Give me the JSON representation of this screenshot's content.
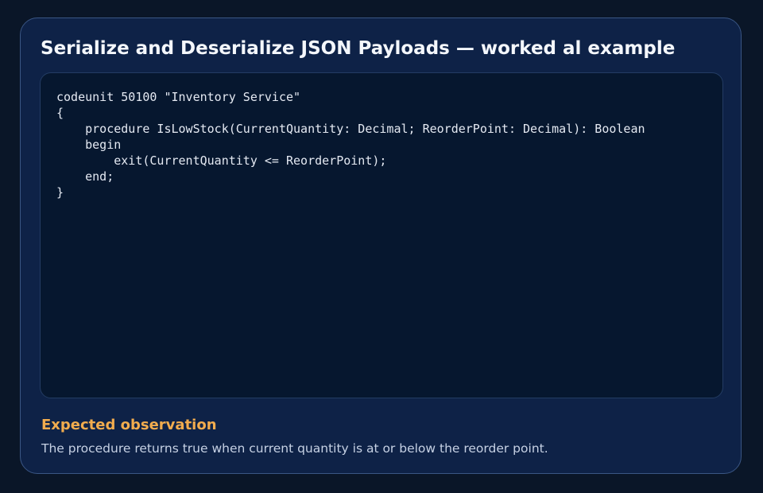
{
  "card": {
    "title": "Serialize and Deserialize JSON Payloads — worked al example",
    "code": "codeunit 50100 \"Inventory Service\"\n{\n    procedure IsLowStock(CurrentQuantity: Decimal; ReorderPoint: Decimal): Boolean\n    begin\n        exit(CurrentQuantity <= ReorderPoint);\n    end;\n}",
    "observation": {
      "heading": "Expected observation",
      "text": "The procedure returns true when current quantity is at or below the reorder point."
    }
  },
  "colors": {
    "background": "#0a1628",
    "card": "#0e2247",
    "code_panel": "#06172f",
    "accent": "#f2ac4e"
  }
}
